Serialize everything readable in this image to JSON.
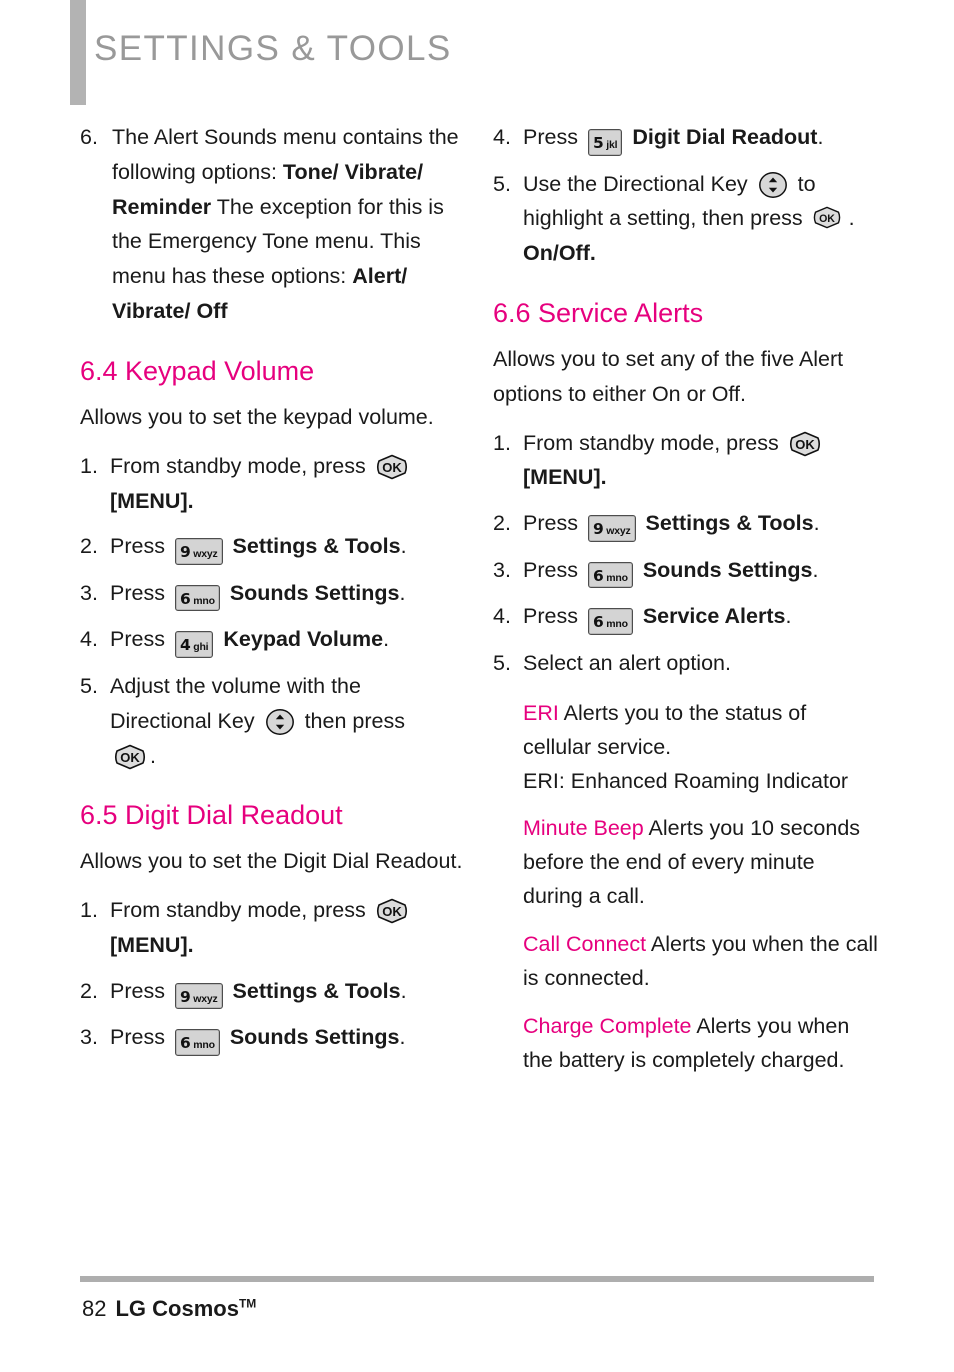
{
  "header": {
    "title": "SETTINGS & TOOLS",
    "accent_color": "#e6007e",
    "title_color": "#999999",
    "bar_color": "#b3b3b3"
  },
  "left_column": {
    "step6": {
      "num": "6.",
      "line1": "The Alert Sounds menu contains",
      "line2": "the following options:",
      "line3_bold": "Tone/ Vibrate/ Reminder",
      "line4": "The exception for this is the",
      "line5": "Emergency Tone menu. This",
      "line6": "menu has these options:",
      "line7_bold": "Alert/ Vibrate/ Off"
    },
    "section_64": {
      "heading": "6.4 Keypad Volume",
      "intro": "Allows you to set the keypad volume.",
      "steps": [
        {
          "num": "1.",
          "text_before": "From standby mode, press",
          "key": "OK",
          "text_after": "[MENU]."
        },
        {
          "num": "2.",
          "text_before": "Press",
          "key_digit": "9",
          "key_letters": "wxyz",
          "bold_label": "Settings & Tools",
          "text_after": "."
        },
        {
          "num": "3.",
          "text_before": "Press",
          "key_digit": "6",
          "key_letters": "mno",
          "bold_label": "Sounds Settings",
          "text_after": "."
        },
        {
          "num": "4.",
          "text_before": "Press",
          "key_digit": "4",
          "key_letters": "ghi",
          "bold_label": "Keypad Volume",
          "text_after": "."
        },
        {
          "num": "5.",
          "line1": "Adjust the volume with the",
          "line2_before": "Directional Key",
          "line2_after": "then press",
          "line3_after": "."
        }
      ]
    },
    "section_65": {
      "heading": "6.5 Digit Dial Readout",
      "intro": "Allows you to set the Digit Dial Readout.",
      "steps": [
        {
          "num": "1.",
          "text_before": "From standby mode, press",
          "key": "OK",
          "text_after": "[MENU]."
        },
        {
          "num": "2.",
          "text_before": "Press",
          "key_digit": "9",
          "key_letters": "wxyz",
          "bold_label": "Settings & Tools",
          "text_after": "."
        },
        {
          "num": "3.",
          "text_before": "Press",
          "key_digit": "6",
          "key_letters": "mno",
          "bold_label": "Sounds Settings",
          "text_after": "."
        }
      ]
    }
  },
  "right_column": {
    "continued_steps": [
      {
        "num": "4.",
        "text_before": "Press",
        "key_digit": "5",
        "key_letters": "jkl",
        "bold_label": "Digit Dial Readout",
        "text_after": "."
      },
      {
        "num": "5.",
        "line1_before": "Use the Directional Key",
        "line1_after": "to",
        "line2_before": "highlight a setting, then press",
        "line2_after": ".",
        "line3_bold": "On/Off."
      }
    ],
    "section_66": {
      "heading": "6.6 Service Alerts",
      "intro": "Allows you to set any of the five Alert options to either On or Off.",
      "steps": [
        {
          "num": "1.",
          "text_before": "From standby mode, press",
          "key": "OK",
          "text_after": "[MENU]."
        },
        {
          "num": "2.",
          "text_before": "Press",
          "key_digit": "9",
          "key_letters": "wxyz",
          "bold_label": "Settings & Tools",
          "text_after": "."
        },
        {
          "num": "3.",
          "text_before": "Press",
          "key_digit": "6",
          "key_letters": "mno",
          "bold_label": "Sounds Settings",
          "text_after": "."
        },
        {
          "num": "4.",
          "text_before": "Press",
          "key_digit": "6",
          "key_letters": "mno",
          "bold_label": "Service Alerts",
          "text_after": "."
        },
        {
          "num": "5.",
          "text_plain": "Select an alert option."
        }
      ],
      "alerts": [
        {
          "name": "ERI",
          "description": "Alerts you to the status of cellular service.",
          "extra": "ERI: Enhanced Roaming Indicator"
        },
        {
          "name": "Minute Beep",
          "description": "Alerts you 10 seconds before the end of every minute during a call."
        },
        {
          "name": "Call Connect",
          "description": "Alerts you when the call is connected."
        },
        {
          "name": "Charge Complete",
          "description": "Alerts you when the battery is completely charged."
        }
      ]
    }
  },
  "footer": {
    "page_number": "82",
    "brand": "LG Cosmos",
    "trademark": "TM"
  }
}
